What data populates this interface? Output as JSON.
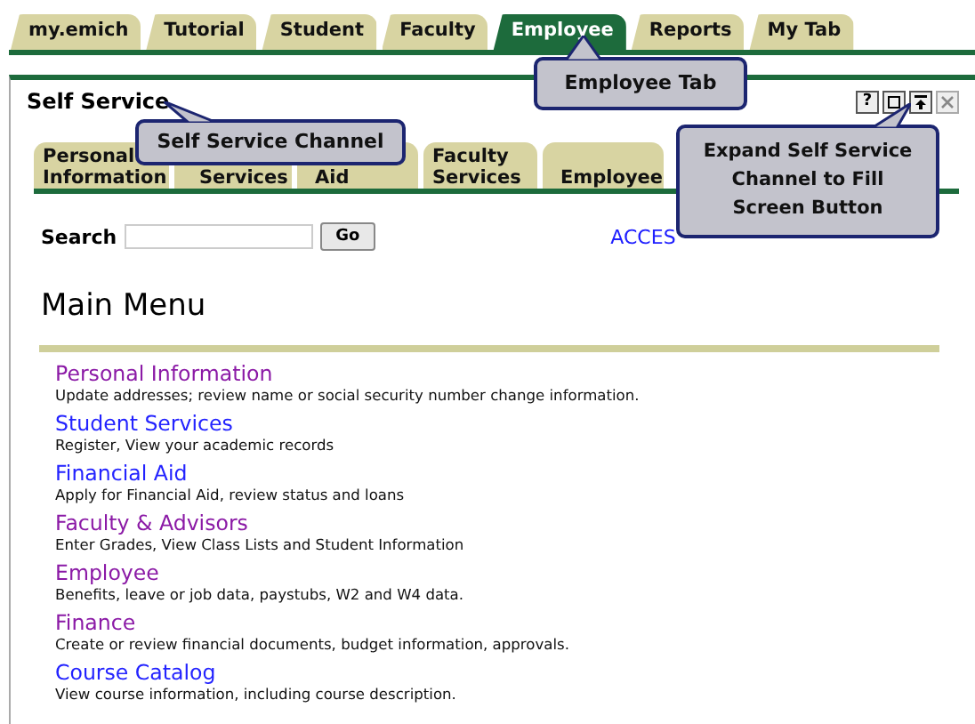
{
  "top_tabs": [
    {
      "label": "my.emich",
      "selected": false
    },
    {
      "label": "Tutorial",
      "selected": false
    },
    {
      "label": "Student",
      "selected": false
    },
    {
      "label": "Faculty",
      "selected": false
    },
    {
      "label": "Employee",
      "selected": true
    },
    {
      "label": "Reports",
      "selected": false
    },
    {
      "label": "My Tab",
      "selected": false
    }
  ],
  "channel": {
    "title": "Self Service",
    "controls": [
      {
        "kind": "help",
        "label": "?",
        "disabled": false
      },
      {
        "kind": "expand",
        "disabled": false
      },
      {
        "kind": "maximize",
        "disabled": false
      },
      {
        "kind": "close",
        "disabled": true
      }
    ],
    "tabs": [
      {
        "label": "Personal Information",
        "selected": false
      },
      {
        "label": "Services",
        "selected": false
      },
      {
        "label": "Aid",
        "selected": false
      },
      {
        "label": "Faculty Services",
        "selected": false
      },
      {
        "label": "Employee",
        "selected": false
      }
    ],
    "search": {
      "label": "Search",
      "button": "Go",
      "link": "ACCES"
    },
    "heading": "Main Menu",
    "menu": [
      {
        "title": "Personal Information",
        "description": "Update addresses; review name or social security number change information.",
        "visited": true
      },
      {
        "title": "Student Services",
        "description": "Register, View your academic records",
        "visited": false
      },
      {
        "title": "Financial Aid",
        "description": "Apply for Financial Aid, review status and loans",
        "visited": false
      },
      {
        "title": "Faculty & Advisors",
        "description": "Enter Grades, View Class Lists and Student Information",
        "visited": true
      },
      {
        "title": "Employee",
        "description": "Benefits, leave or job data, paystubs, W2 and W4 data.",
        "visited": true
      },
      {
        "title": "Finance",
        "description": "Create or review financial documents, budget information, approvals.",
        "visited": true
      },
      {
        "title": "Course Catalog",
        "description": "View course information, including course description.",
        "visited": false
      }
    ]
  },
  "callouts": [
    {
      "text": "Employee Tab",
      "kind": "tab"
    },
    {
      "text": "Self Service Channel",
      "kind": "channel"
    },
    {
      "text": "Expand Self Service Channel to Fill Screen Button",
      "kind": "button"
    }
  ]
}
